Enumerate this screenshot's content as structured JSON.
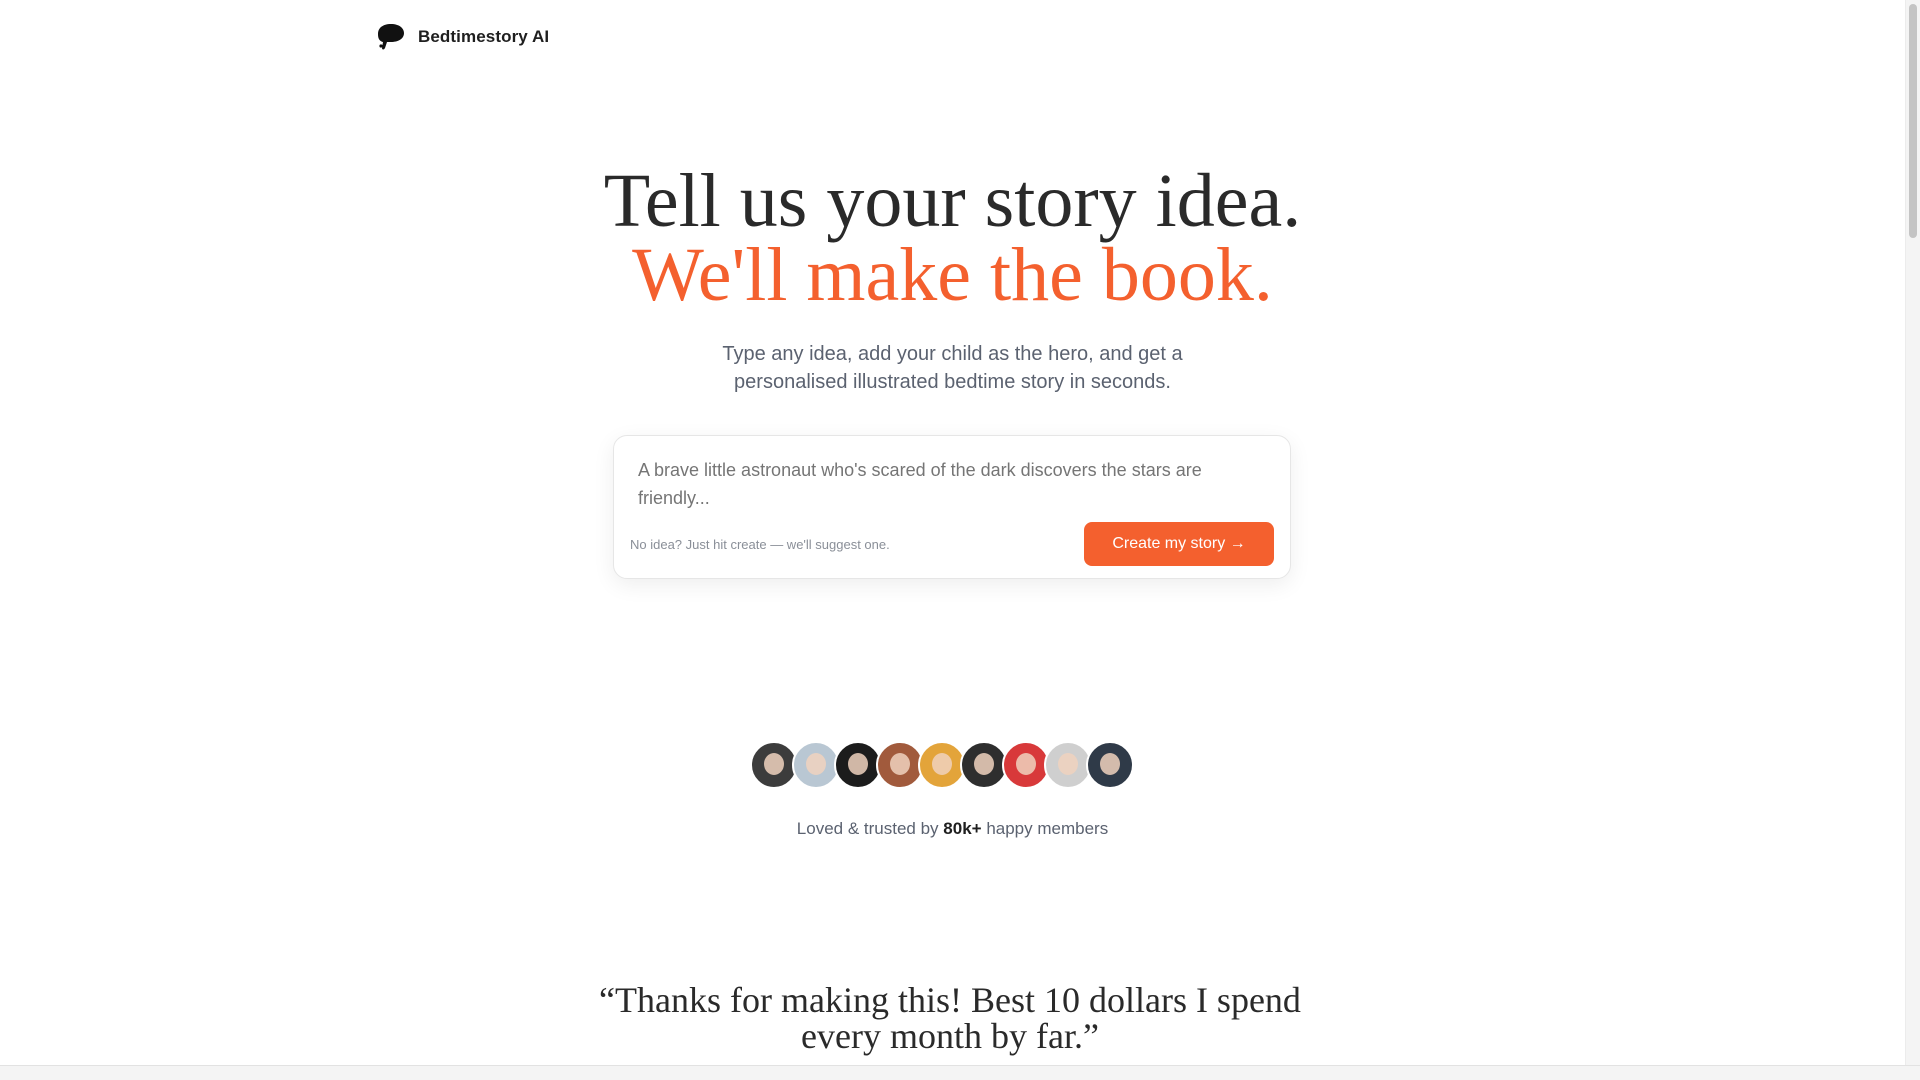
{
  "header": {
    "brand_name": "Bedtimestory AI",
    "logo_icon": "bird-cloud-logo"
  },
  "hero": {
    "title_line1": "Tell us your story idea.",
    "title_line2": "We'll make the book.",
    "subtitle": "Type any idea, add your child as the hero, and get a personalised illustrated bedtime story in seconds.",
    "accent_color": "#f4602e"
  },
  "prompt_card": {
    "placeholder": "A brave little astronaut who's scared of the dark discovers the stars are friendly...",
    "value": "",
    "hint": "No idea? Just hit create — we'll suggest one.",
    "cta_label": "Create my story →"
  },
  "social_proof": {
    "avatars": [
      {
        "name": "member-avatar-1",
        "bg": "#3c3c3c"
      },
      {
        "name": "member-avatar-2",
        "bg": "#b9c7d3"
      },
      {
        "name": "member-avatar-3",
        "bg": "#1c1c1c"
      },
      {
        "name": "member-avatar-4",
        "bg": "#a15a3c"
      },
      {
        "name": "member-avatar-5",
        "bg": "#e3a43a"
      },
      {
        "name": "member-avatar-6",
        "bg": "#2e2e2e"
      },
      {
        "name": "member-avatar-7",
        "bg": "#d8393a"
      },
      {
        "name": "member-avatar-8",
        "bg": "#cfcfcf"
      },
      {
        "name": "member-avatar-9",
        "bg": "#2f3a48"
      }
    ],
    "trusted_prefix": "Loved & trusted by",
    "trusted_count": "80k+",
    "trusted_suffix": "happy members"
  },
  "testimonial": {
    "quote": "“Thanks for making this! Best 10 dollars I spend every month by far.”"
  }
}
